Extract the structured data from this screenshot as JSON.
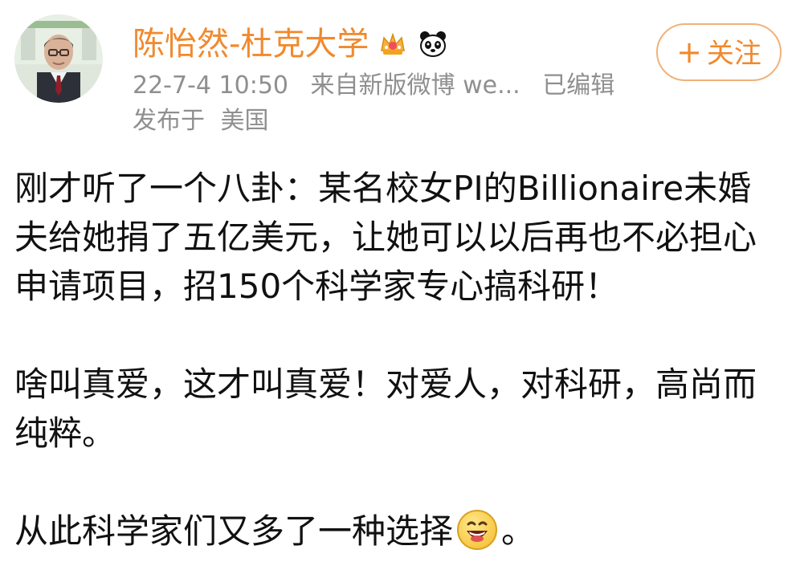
{
  "post": {
    "author": {
      "name": "陈怡然-杜克大学"
    },
    "meta": {
      "time": "22-7-4 10:50",
      "source": "来自新版微博 we...",
      "edited": "已编辑"
    },
    "location": {
      "prefix": "发布于",
      "country": "美国"
    },
    "follow_button": {
      "plus": "+",
      "label": "关注"
    },
    "paragraphs": {
      "p1_line1": "刚才听了一个八卦：某名校女PI的Billionaire未婚",
      "p1_line2": "夫给她捐了五亿美元，让她可以以后再也不必担心",
      "p1_line3": "申请项目，招150个科学家专心搞科研！",
      "p2_line1": "啥叫真爱，这才叫真爱！对爱人，对科研，高尚而",
      "p2_line2": "纯粹。",
      "p3_text": "从此科学家们又多了一种选择",
      "p3_end": "。"
    }
  },
  "icons": {
    "badge_1": "crown-badge-icon",
    "badge_2": "panda-icon",
    "emoji": "laughing-emoji-icon"
  },
  "colors": {
    "accent": "#f1892d",
    "follow_border": "#f0b27a",
    "meta_text": "#8f8f8f",
    "body_text": "#111111",
    "background": "#ffffff"
  }
}
